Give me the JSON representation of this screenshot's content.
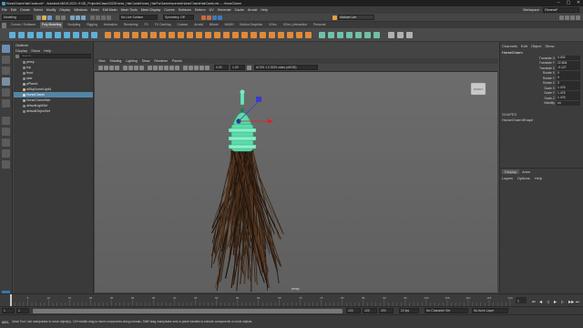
{
  "window": {
    "title": "HorseCharmHairCards.mb* - Autodesk MAYA 2023: H:\\3D_Projects\\Class\\2023\\Horse_HairCards\\Horse_HairForGames\\scenes\\HorseCharmHairCards.mb --- HorseCharm",
    "min": "–",
    "max": "▢",
    "close": "✕"
  },
  "menubar": [
    "File",
    "Edit",
    "Create",
    "Select",
    "Modify",
    "Display",
    "Windows",
    "Mesh",
    "Edit Mesh",
    "Mesh Tools",
    "Mesh Display",
    "Curves",
    "Surfaces",
    "Deform",
    "UV",
    "Generate",
    "Cache",
    "Arnold",
    "Help"
  ],
  "workspace": {
    "label": "Workspace :",
    "value": "General*"
  },
  "statusline": {
    "mode": "Modeling",
    "no_live_surface": "No Live Surface",
    "symmetry": "Symmetry: Off",
    "account": "Michael Lee",
    "colors": {
      "accent": "#e8a23a",
      "signin": "#5285a6"
    }
  },
  "shelf": {
    "tabs": [
      "Curves / Surfaces",
      "Poly Modeling",
      "Sculpting",
      "Rigging",
      "Animation",
      "Rendering",
      "FX",
      "FX Caching",
      "Custom",
      "Arnold",
      "Bifrost",
      "MASH",
      "Motion Graphics",
      "XGen",
      "XGen_Interactive",
      "Personal"
    ],
    "active_tab": 1
  },
  "outliner": {
    "title": "Outliner",
    "menu": [
      "Display",
      "Show",
      "Help"
    ],
    "search_placeholder": "Search...",
    "items": [
      {
        "label": "persp",
        "selected": false
      },
      {
        "label": "top",
        "selected": false
      },
      {
        "label": "front",
        "selected": false
      },
      {
        "label": "side",
        "selected": false
      },
      {
        "label": "pPlane1",
        "selected": false
      },
      {
        "label": "aiSkyDomeLight1",
        "selected": false
      },
      {
        "label": "HorseCharm",
        "selected": true
      },
      {
        "label": "HorseCharmHair",
        "selected": false
      },
      {
        "label": "defaultLightSet",
        "selected": false
      },
      {
        "label": "defaultObjectSet",
        "selected": false
      }
    ]
  },
  "viewport": {
    "menu": [
      "View",
      "Shading",
      "Lighting",
      "Show",
      "Renderer",
      "Panels"
    ],
    "gamma": "0.00",
    "exposure": "1.00",
    "colorspace": "ACES 1.0 SDR-video (sRGB)",
    "camera_label": "persp",
    "viewcube_label": "FRONT"
  },
  "channelbox": {
    "tabs": [
      "Channels",
      "Edit",
      "Object",
      "Show"
    ],
    "object_name": "HorseCharm",
    "attributes": [
      {
        "name": "Translate X",
        "value": "0.002"
      },
      {
        "name": "Translate Y",
        "value": "22.804"
      },
      {
        "name": "Translate Z",
        "value": "-0.127"
      },
      {
        "name": "Rotate X",
        "value": "0"
      },
      {
        "name": "Rotate Y",
        "value": "0"
      },
      {
        "name": "Rotate Z",
        "value": "0"
      },
      {
        "name": "Scale X",
        "value": "1.476"
      },
      {
        "name": "Scale Y",
        "value": "1.476"
      },
      {
        "name": "Scale Z",
        "value": "1.476"
      },
      {
        "name": "Visibility",
        "value": "on"
      }
    ],
    "shapes_label": "SHAPES",
    "shape_name": "HorseCharmShape"
  },
  "layers": {
    "tabs": [
      "Display",
      "Anim"
    ],
    "menu": [
      "Layers",
      "Options",
      "Help"
    ]
  },
  "timeline": {
    "ticks": [
      "5",
      "10",
      "15",
      "20",
      "25",
      "30",
      "35",
      "40",
      "45",
      "50",
      "55",
      "60",
      "65",
      "70",
      "75",
      "80",
      "85",
      "90",
      "95",
      "100",
      "105",
      "110",
      "115",
      "120"
    ],
    "current_frame": "1",
    "range_start": "1",
    "range_inner_start": "1",
    "range_end": "120",
    "range_inner_end": "120",
    "anim_end": "200",
    "fps": "24 fps",
    "no_character_set": "No Character Set",
    "no_anim_layer": "No Anim Layer"
  },
  "helpline": {
    "mel_label": "MEL",
    "text": "Move Tool: Use manipulator to move object(s). Ctrl+middle-drag to move components along normals. Shift+drag manipulator axis or plane handles to extrude components or clone objects."
  }
}
